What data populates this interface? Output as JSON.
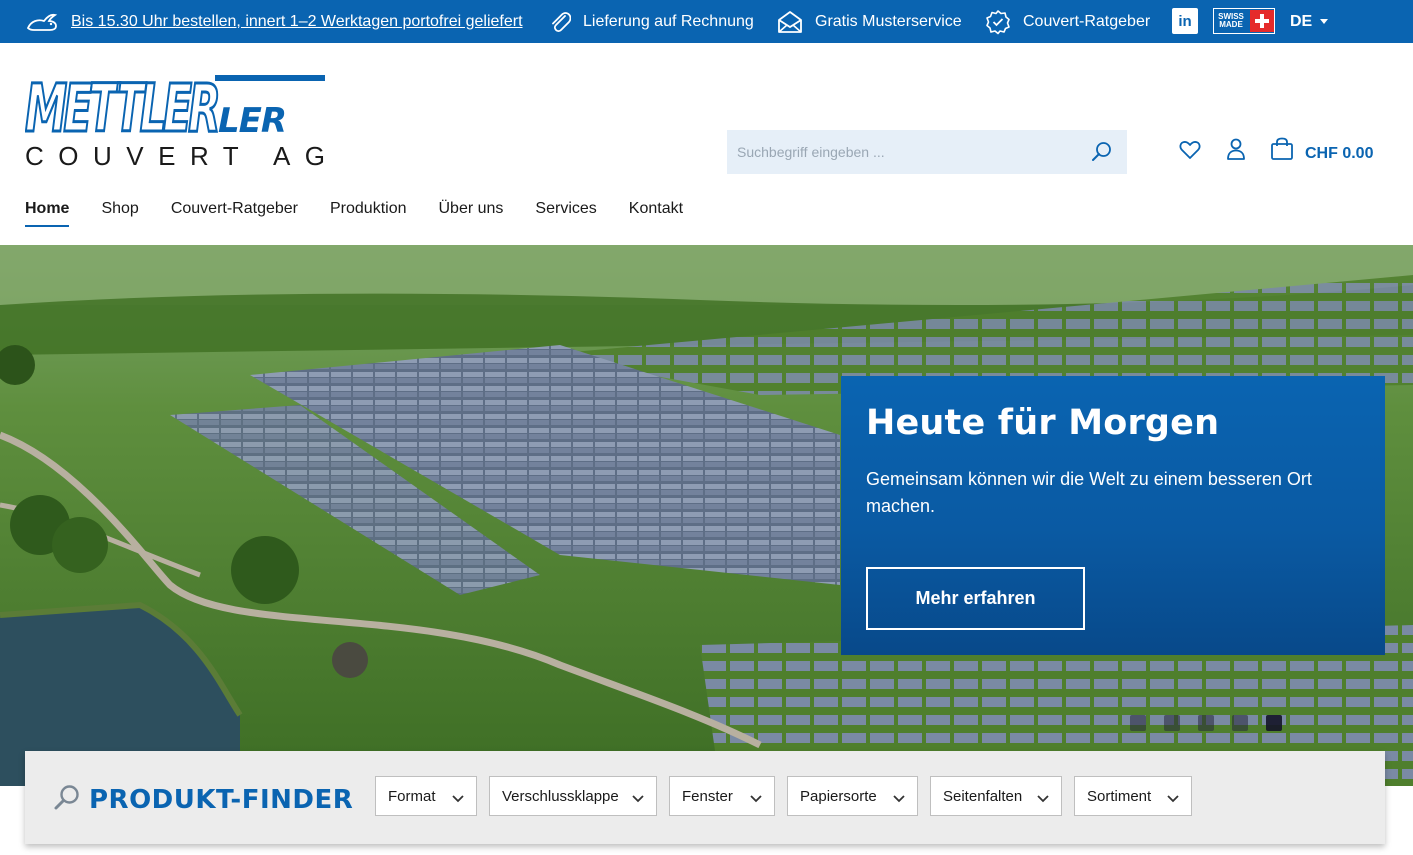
{
  "topbar": {
    "shipping": "Bis 15.30 Uhr bestellen, innert 1–2 Werktagen portofrei geliefert",
    "invoice": "Lieferung auf Rechnung",
    "samples": "Gratis Musterservice",
    "guide": "Couvert-Ratgeber",
    "linkedin": "in",
    "swiss_made": "SWISS MADE",
    "language": "DE"
  },
  "logo": {
    "brand": "METTLER",
    "tagline": "COUVERT AG"
  },
  "search": {
    "placeholder": "Suchbegriff eingeben ..."
  },
  "cart": {
    "total": "CHF 0.00"
  },
  "nav": {
    "items": [
      {
        "label": "Home",
        "active": true
      },
      {
        "label": "Shop"
      },
      {
        "label": "Couvert-Ratgeber"
      },
      {
        "label": "Produktion"
      },
      {
        "label": "Über uns"
      },
      {
        "label": "Services"
      },
      {
        "label": "Kontakt"
      }
    ]
  },
  "hero": {
    "title": "Heute für Morgen",
    "subtitle": "Gemeinsam können wir die Welt zu einem besseren Ort machen.",
    "button": "Mehr erfahren"
  },
  "finder": {
    "title": "PRODUKT-FINDER",
    "filters": [
      {
        "label": "Format"
      },
      {
        "label": "Verschlussklappe"
      },
      {
        "label": "Fenster"
      },
      {
        "label": "Papiersorte"
      },
      {
        "label": "Seitenfalten"
      },
      {
        "label": "Sortiment"
      }
    ]
  },
  "colors": {
    "brand_blue": "#0a64b1",
    "topbar": "#0a64b1",
    "search_bg": "#e6eff8",
    "finder_bg": "#ececec"
  }
}
